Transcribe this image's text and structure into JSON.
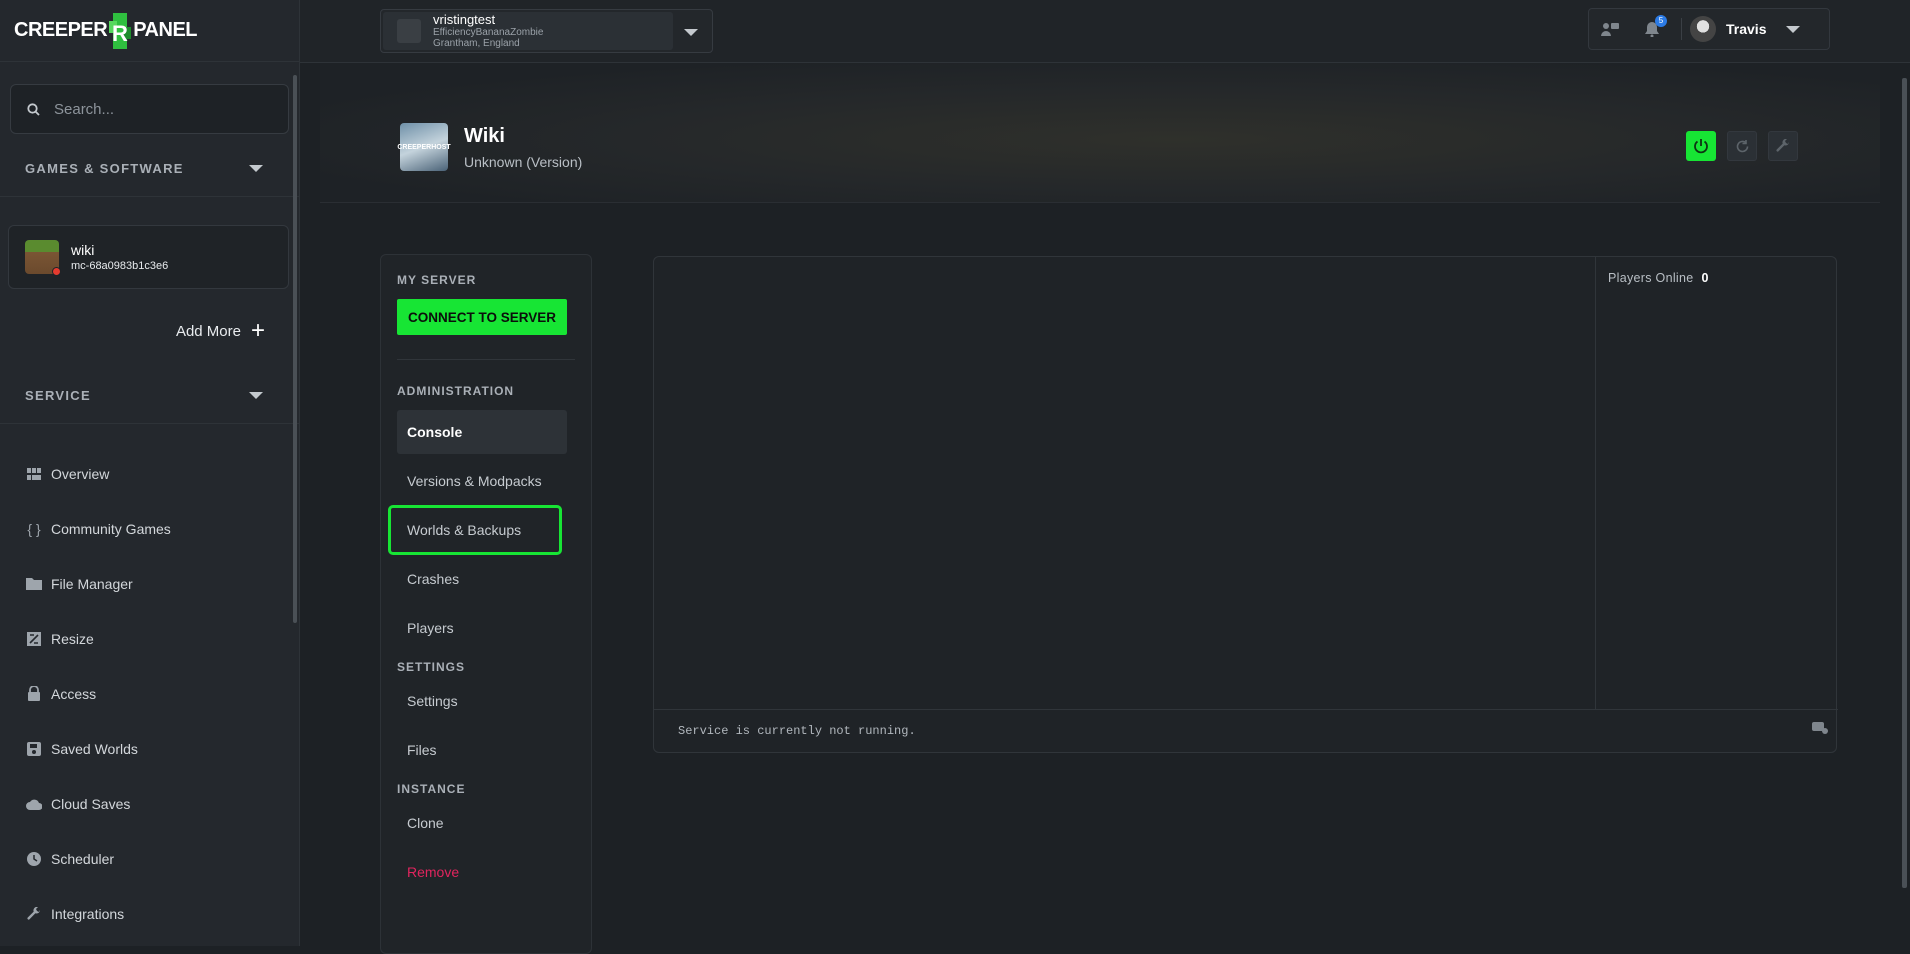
{
  "sidebar": {
    "logo_left": "CREEPER",
    "logo_right": "PANEL",
    "search_placeholder": "Search...",
    "games_heading": "GAMES & SOFTWARE",
    "server": {
      "name": "wiki",
      "id": "mc-68a0983b1c3e6",
      "status_color": "#e53b2f"
    },
    "add_more": "Add More",
    "service_heading": "SERVICE",
    "nav": [
      {
        "label": "Overview",
        "icon": "grid-icon"
      },
      {
        "label": "Community Games",
        "icon": "braces-icon"
      },
      {
        "label": "File Manager",
        "icon": "folder-icon"
      },
      {
        "label": "Resize",
        "icon": "resize-icon"
      },
      {
        "label": "Access",
        "icon": "lock-icon"
      },
      {
        "label": "Saved Worlds",
        "icon": "save-icon"
      },
      {
        "label": "Cloud Saves",
        "icon": "cloud-icon"
      },
      {
        "label": "Scheduler",
        "icon": "clock-icon"
      },
      {
        "label": "Integrations",
        "icon": "wrench-icon"
      }
    ]
  },
  "topbar": {
    "account_name": "vristingtest",
    "account_sub1": "EfficiencyBananaZombie",
    "account_sub2": "Grantham, England",
    "notification_count": "5",
    "user_name": "Travis"
  },
  "header": {
    "title": "Wiki",
    "version": "Unknown (Version)",
    "thumb_text": "CREEPERHOST"
  },
  "menu": {
    "my_server": "MY SERVER",
    "connect": "CONNECT TO SERVER",
    "administration": "ADMINISTRATION",
    "admin_links": [
      "Console",
      "Versions & Modpacks",
      "Worlds & Backups",
      "Crashes",
      "Players"
    ],
    "settings": "SETTINGS",
    "settings_links": [
      "Settings",
      "Files"
    ],
    "instance": "INSTANCE",
    "instance_links": [
      "Clone",
      "Remove"
    ]
  },
  "console": {
    "players_label": "Players Online",
    "players_count": "0",
    "status": "Service is currently not running."
  },
  "colors": {
    "accent": "#17e534",
    "danger": "#e0245e",
    "badge": "#2c7be5"
  }
}
